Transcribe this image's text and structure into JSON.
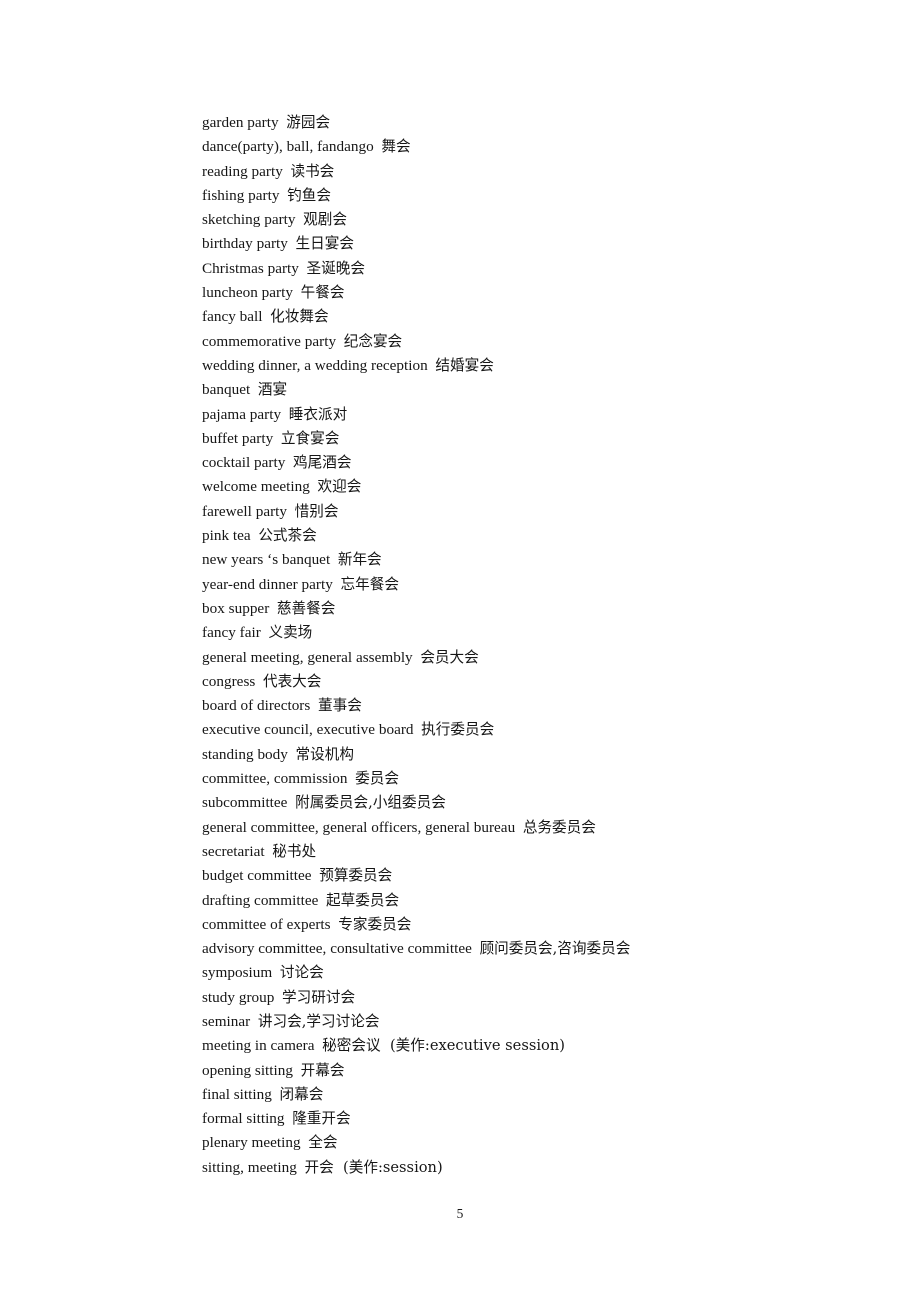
{
  "document": {
    "page_number": "5",
    "entries": [
      {
        "term": "garden party",
        "gap": "  ",
        "gloss": "游园会",
        "note": ""
      },
      {
        "term": "dance(party), ball, fandango",
        "gap": "  ",
        "gloss": "舞会",
        "note": ""
      },
      {
        "term": "reading party",
        "gap": "  ",
        "gloss": "读书会",
        "note": ""
      },
      {
        "term": "fishing party",
        "gap": "  ",
        "gloss": "钓鱼会",
        "note": ""
      },
      {
        "term": "sketching party",
        "gap": "  ",
        "gloss": "观剧会",
        "note": ""
      },
      {
        "term": "birthday party",
        "gap": "  ",
        "gloss": "生日宴会",
        "note": ""
      },
      {
        "term": "Christmas party",
        "gap": "  ",
        "gloss": "圣诞晚会",
        "note": ""
      },
      {
        "term": "luncheon party",
        "gap": "  ",
        "gloss": "午餐会",
        "note": ""
      },
      {
        "term": "fancy ball",
        "gap": "  ",
        "gloss": "化妆舞会",
        "note": ""
      },
      {
        "term": "commemorative party",
        "gap": "  ",
        "gloss": "纪念宴会",
        "note": ""
      },
      {
        "term": "wedding dinner, a wedding reception",
        "gap": "  ",
        "gloss": "结婚宴会",
        "note": ""
      },
      {
        "term": "banquet",
        "gap": "  ",
        "gloss": "酒宴",
        "note": ""
      },
      {
        "term": "pajama party",
        "gap": "  ",
        "gloss": "睡衣派对",
        "note": ""
      },
      {
        "term": "buffet party",
        "gap": "  ",
        "gloss": "立食宴会",
        "note": ""
      },
      {
        "term": "cocktail party",
        "gap": "  ",
        "gloss": "鸡尾酒会",
        "note": ""
      },
      {
        "term": "welcome meeting",
        "gap": "  ",
        "gloss": "欢迎会",
        "note": ""
      },
      {
        "term": "farewell party",
        "gap": "  ",
        "gloss": "惜别会",
        "note": ""
      },
      {
        "term": "pink tea",
        "gap": "  ",
        "gloss": "公式茶会",
        "note": ""
      },
      {
        "term": "new years ‘s banquet",
        "gap": "  ",
        "gloss": "新年会",
        "note": ""
      },
      {
        "term": "year-end dinner party",
        "gap": "  ",
        "gloss": "忘年餐会",
        "note": ""
      },
      {
        "term": "box supper",
        "gap": "  ",
        "gloss": "慈善餐会",
        "note": ""
      },
      {
        "term": "fancy fair",
        "gap": "  ",
        "gloss": "义卖场",
        "note": ""
      },
      {
        "term": "general meeting, general assembly",
        "gap": "  ",
        "gloss": "会员大会",
        "note": ""
      },
      {
        "term": "congress",
        "gap": "  ",
        "gloss": "代表大会",
        "note": ""
      },
      {
        "term": "board of directors",
        "gap": "  ",
        "gloss": "董事会",
        "note": ""
      },
      {
        "term": "executive council, executive board",
        "gap": "  ",
        "gloss": "执行委员会",
        "note": ""
      },
      {
        "term": "standing body",
        "gap": "  ",
        "gloss": "常设机构",
        "note": ""
      },
      {
        "term": "committee, commission",
        "gap": "  ",
        "gloss": "委员会",
        "note": ""
      },
      {
        "term": "subcommittee",
        "gap": "  ",
        "gloss": "附属委员会,小组委员会",
        "note": ""
      },
      {
        "term": "general committee, general officers, general bureau",
        "gap": "  ",
        "gloss": "总务委员会",
        "note": ""
      },
      {
        "term": "secretariat",
        "gap": "  ",
        "gloss": "秘书处",
        "note": ""
      },
      {
        "term": "budget committee",
        "gap": "  ",
        "gloss": "预算委员会",
        "note": ""
      },
      {
        "term": "drafting committee",
        "gap": "  ",
        "gloss": "起草委员会",
        "note": ""
      },
      {
        "term": "committee of experts",
        "gap": "  ",
        "gloss": "专家委员会",
        "note": ""
      },
      {
        "term": "advisory committee, consultative committee",
        "gap": "  ",
        "gloss": "顾问委员会,咨询委员会",
        "note": ""
      },
      {
        "term": "symposium",
        "gap": "  ",
        "gloss": "讨论会",
        "note": ""
      },
      {
        "term": "study group",
        "gap": "  ",
        "gloss": "学习研讨会",
        "note": ""
      },
      {
        "term": "seminar",
        "gap": "  ",
        "gloss": "讲习会,学习讨论会",
        "note": ""
      },
      {
        "term": "meeting in camera",
        "gap": "  ",
        "gloss": "秘密会议",
        "note": "  (美作:executive session)"
      },
      {
        "term": "opening sitting",
        "gap": "  ",
        "gloss": "开幕会",
        "note": ""
      },
      {
        "term": "final sitting",
        "gap": "  ",
        "gloss": "闭幕会",
        "note": ""
      },
      {
        "term": "formal sitting",
        "gap": "  ",
        "gloss": "隆重开会",
        "note": ""
      },
      {
        "term": "plenary meeting",
        "gap": "  ",
        "gloss": "全会",
        "note": ""
      },
      {
        "term": "sitting, meeting",
        "gap": "  ",
        "gloss": "开会",
        "note": "  (美作:session)"
      }
    ]
  }
}
